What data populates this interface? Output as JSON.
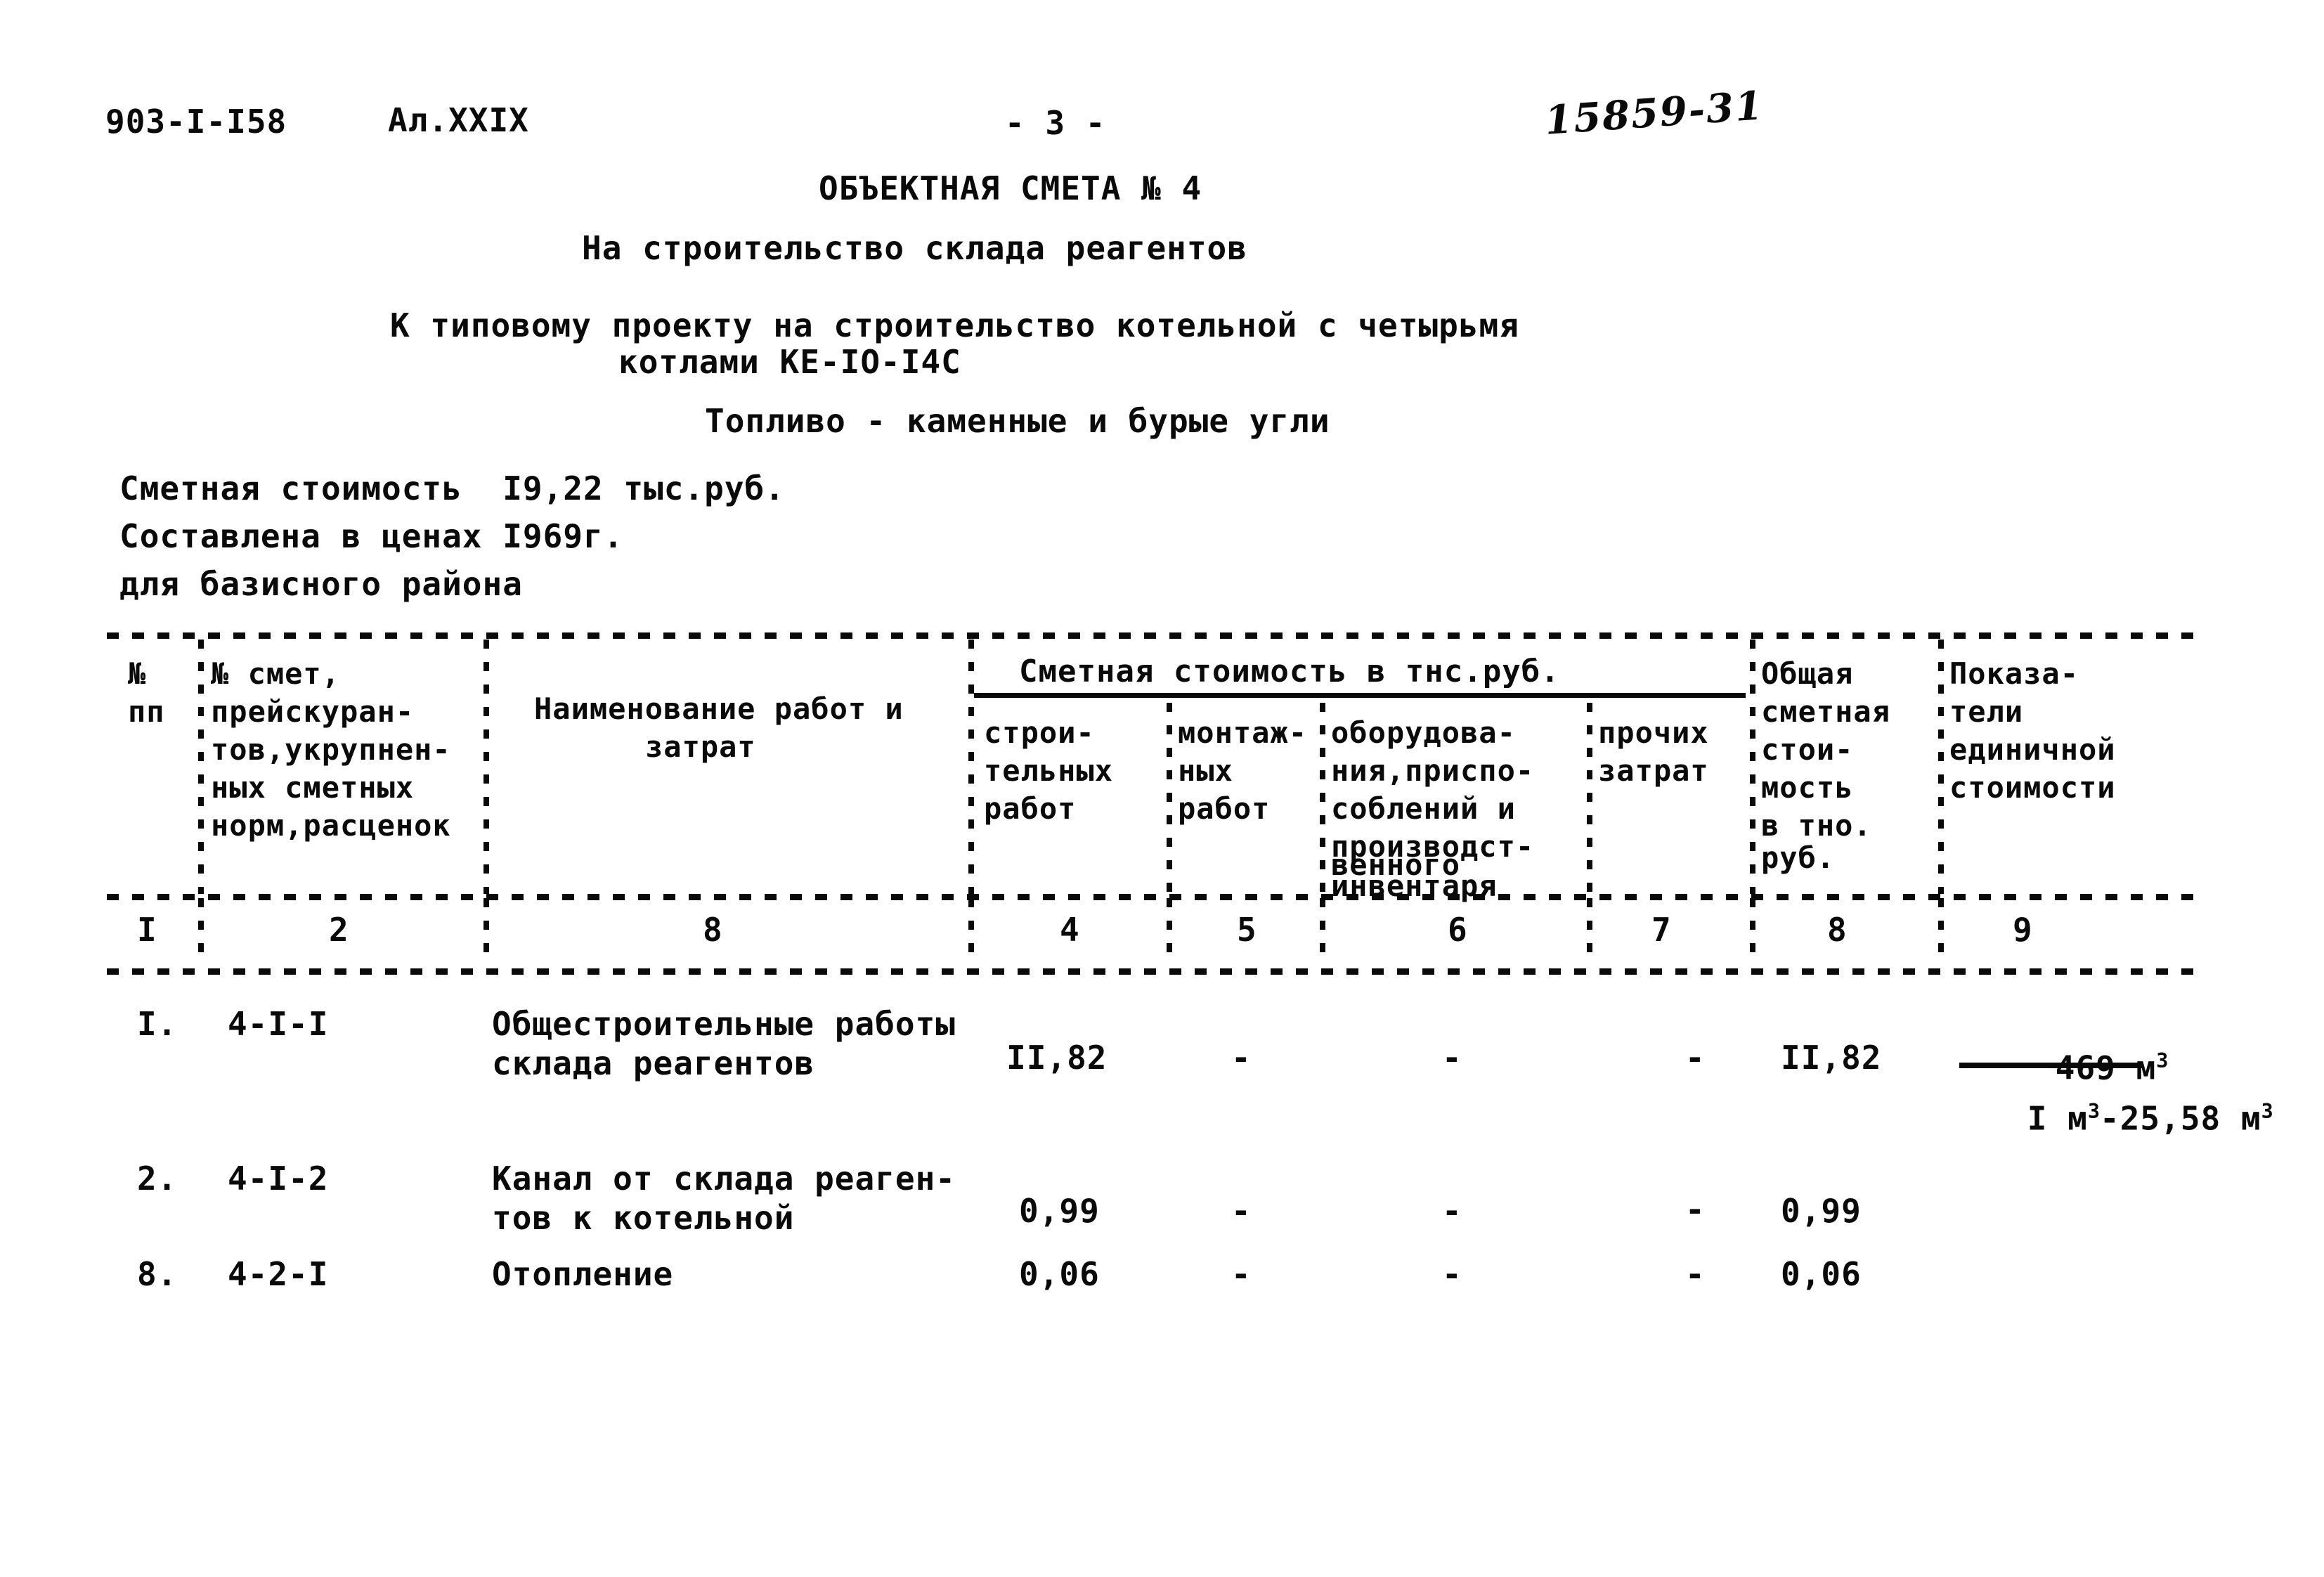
{
  "header": {
    "project_code": "903-I-I58",
    "album": "Ал.XXIX",
    "page_number": "- 3 -",
    "archive_number": "15859-31"
  },
  "titles": {
    "main": "ОБЪЕКТНАЯ СМЕТА № 4",
    "subtitle": "На строительство склада реагентов",
    "reference_line1": "К типовому проекту на строительство котельной с четырьмя",
    "reference_line2": "котлами КЕ-IО-I4С",
    "fuel": "Топливо - каменные и бурые угли"
  },
  "summary": {
    "cost_line": "Сметная стоимость  I9,22 тыс.руб.",
    "prices_line": "Составлена в ценах I969г.",
    "region_line": "для базисного района"
  },
  "table": {
    "group_header": "Сметная стоимость в тнс.руб.",
    "columns": [
      {
        "num": "I",
        "lines": [
          "№",
          "пп"
        ]
      },
      {
        "num": "2",
        "lines": [
          "№ смет,",
          "прейскуран-",
          "тов,укрупнен-",
          "ных сметных",
          "норм,расценок"
        ]
      },
      {
        "num": "8",
        "lines": [
          "Наименование работ и",
          "затрат"
        ]
      },
      {
        "num": "4",
        "lines": [
          "строи-",
          "тельных",
          "работ"
        ]
      },
      {
        "num": "5",
        "lines": [
          "монтаж-",
          "ных",
          "работ"
        ]
      },
      {
        "num": "6",
        "lines": [
          "оборудова-",
          "ния,приспо-",
          "соблений и",
          "производст-",
          "венного",
          "инвентаря"
        ]
      },
      {
        "num": "7",
        "lines": [
          "прочих",
          "затрат"
        ]
      },
      {
        "num": "8",
        "lines": [
          "Общая",
          "сметная",
          "стои-",
          "мость",
          "в тно.",
          "руб."
        ]
      },
      {
        "num": "9",
        "lines": [
          "Показа-",
          "тели",
          "единичной",
          "стоимости"
        ]
      }
    ],
    "rows": [
      {
        "no": "I.",
        "code": "4-I-I",
        "name_line1": "Общестроительные работы",
        "name_line2": "склада реагентов",
        "construction": "II,82",
        "installation": "-",
        "equipment": "-",
        "other": "-",
        "total": "II,82",
        "unit_numerator": "469 м",
        "unit_numerator_sup": "3",
        "unit_denominator_a": "I м",
        "unit_denominator_a_sup": "3",
        "unit_denominator_b": "-25,58 м",
        "unit_denominator_b_sup": "3"
      },
      {
        "no": "2.",
        "code": "4-I-2",
        "name_line1": "Канал от склада реаген-",
        "name_line2": "тов к котельной",
        "construction": "0,99",
        "installation": "-",
        "equipment": "-",
        "other": "-",
        "total": "0,99",
        "unit_numerator": "",
        "unit_numerator_sup": "",
        "unit_denominator_a": "",
        "unit_denominator_a_sup": "",
        "unit_denominator_b": "",
        "unit_denominator_b_sup": ""
      },
      {
        "no": "8.",
        "code": "4-2-I",
        "name_line1": "Отопление",
        "name_line2": "",
        "construction": "0,06",
        "installation": "-",
        "equipment": "-",
        "other": "-",
        "total": "0,06",
        "unit_numerator": "",
        "unit_numerator_sup": "",
        "unit_denominator_a": "",
        "unit_denominator_a_sup": "",
        "unit_denominator_b": "",
        "unit_denominator_b_sup": ""
      }
    ]
  }
}
